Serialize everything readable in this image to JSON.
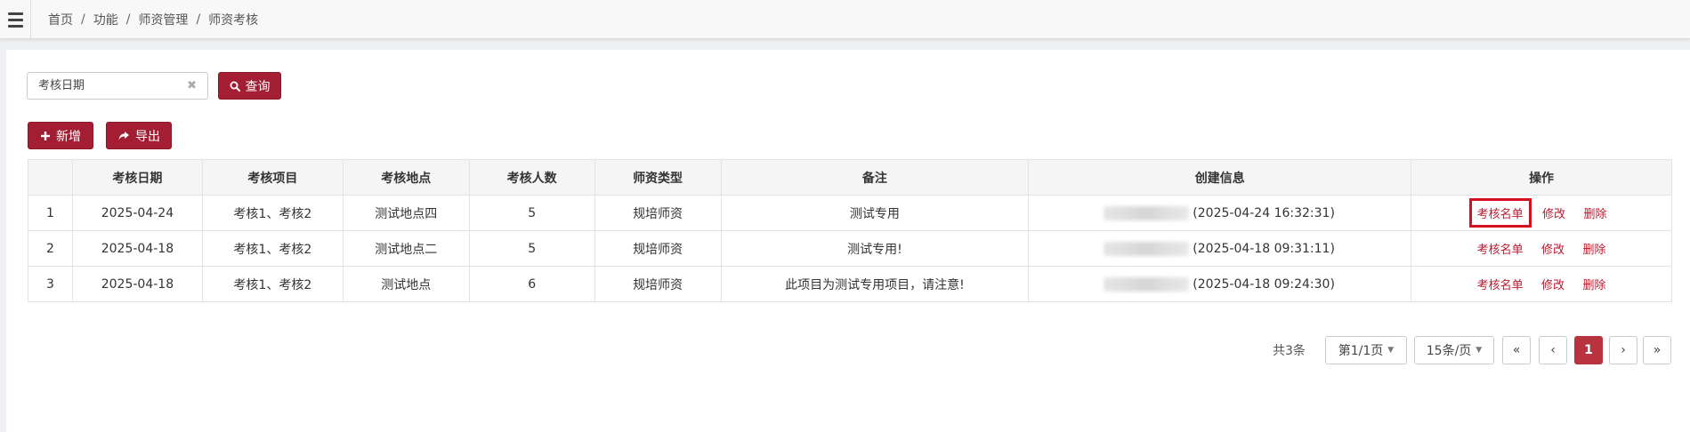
{
  "breadcrumb": {
    "items": [
      "首页",
      "功能",
      "师资管理",
      "师资考核"
    ],
    "separator": "/"
  },
  "search": {
    "placeholder": "考核日期",
    "clear_icon": "✖",
    "button_label": "查询"
  },
  "toolbar": {
    "add_label": "新增",
    "export_label": "导出"
  },
  "table": {
    "headers": [
      "",
      "考核日期",
      "考核项目",
      "考核地点",
      "考核人数",
      "师资类型",
      "备注",
      "创建信息",
      "操作"
    ],
    "rows": [
      {
        "no": "1",
        "date": "2025-04-24",
        "items": "考核1、考核2",
        "place": "测试地点四",
        "count": "5",
        "type": "规培师资",
        "remark": "测试专用",
        "created": "(2025-04-24 16:32:31)"
      },
      {
        "no": "2",
        "date": "2025-04-18",
        "items": "考核1、考核2",
        "place": "测试地点二",
        "count": "5",
        "type": "规培师资",
        "remark": "测试专用!",
        "created": "(2025-04-18 09:31:11)"
      },
      {
        "no": "3",
        "date": "2025-04-18",
        "items": "考核1、考核2",
        "place": "测试地点",
        "count": "6",
        "type": "规培师资",
        "remark": "此项目为测试专用项目，请注意!",
        "created": "(2025-04-18 09:24:30)"
      }
    ],
    "actions": {
      "roster": "考核名单",
      "edit": "修改",
      "delete": "删除"
    }
  },
  "pager": {
    "total": "共3条",
    "page_select": "第1/1页",
    "size_select": "15条/页",
    "first": "«",
    "prev": "‹",
    "current": "1",
    "next": "›",
    "last": "»"
  },
  "colors": {
    "accent": "#a31d33",
    "link": "#c0182c",
    "highlight_border": "#d60f1f"
  }
}
